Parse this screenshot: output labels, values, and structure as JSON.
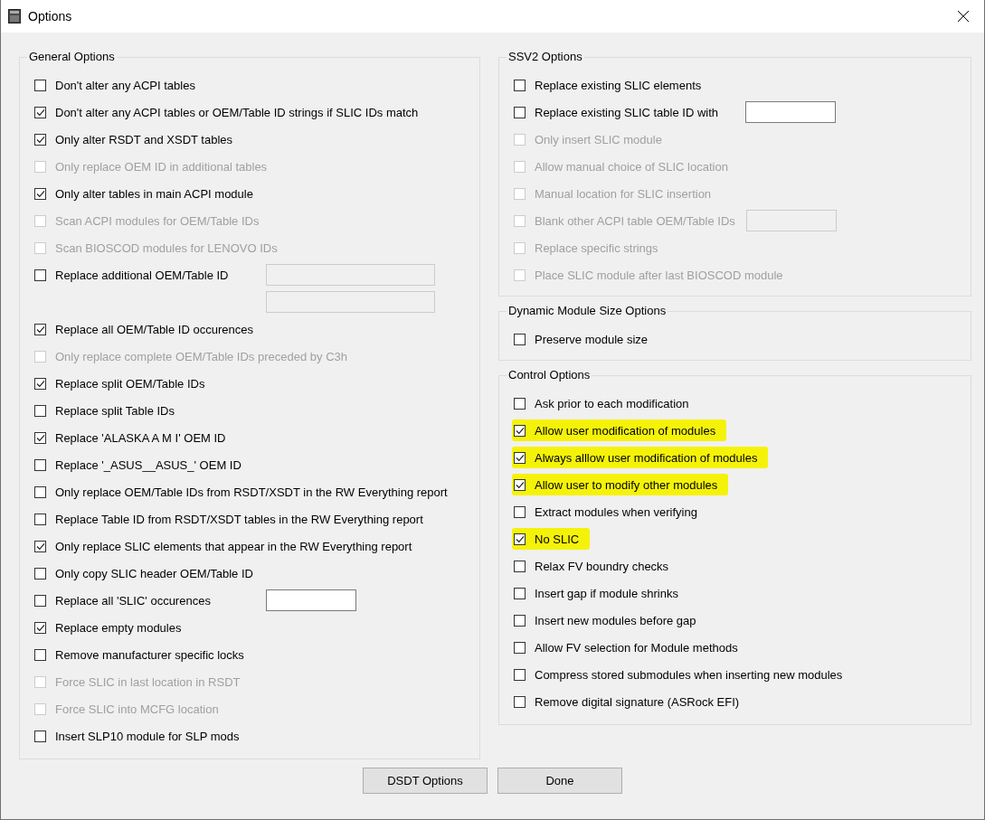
{
  "window": {
    "title": "Options"
  },
  "columns": [
    {
      "groups": [
        {
          "title": "General Options",
          "items": [
            {
              "label": "Don't alter any ACPI tables",
              "checked": false,
              "disabled": false,
              "highlighted": false
            },
            {
              "label": "Don't alter any ACPI tables or OEM/Table ID strings if SLIC IDs match",
              "checked": true,
              "disabled": false,
              "highlighted": false
            },
            {
              "label": "Only alter RSDT and XSDT tables",
              "checked": true,
              "disabled": false,
              "highlighted": false
            },
            {
              "label": "Only replace OEM ID in additional tables",
              "checked": false,
              "disabled": true,
              "highlighted": false
            },
            {
              "label": "Only alter tables in main ACPI module",
              "checked": true,
              "disabled": false,
              "highlighted": false
            },
            {
              "label": "Scan ACPI modules for OEM/Table IDs",
              "checked": false,
              "disabled": true,
              "highlighted": false
            },
            {
              "label": "Scan BIOSCOD modules for LENOVO IDs",
              "checked": false,
              "disabled": true,
              "highlighted": false
            },
            {
              "label": "Replace additional OEM/Table ID",
              "checked": false,
              "disabled": false,
              "highlighted": false,
              "fields": [
                {
                  "disabled": true,
                  "kind": "wide"
                },
                {
                  "disabled": true,
                  "kind": "wide"
                }
              ]
            },
            {
              "label": "Replace all OEM/Table ID occurences",
              "checked": true,
              "disabled": false,
              "highlighted": false
            },
            {
              "label": "Only replace complete OEM/Table IDs preceded by C3h",
              "checked": false,
              "disabled": true,
              "highlighted": false
            },
            {
              "label": "Replace split OEM/Table IDs",
              "checked": true,
              "disabled": false,
              "highlighted": false
            },
            {
              "label": "Replace split Table IDs",
              "checked": false,
              "disabled": false,
              "highlighted": false
            },
            {
              "label": "Replace 'ALASKA A M I'  OEM ID",
              "checked": true,
              "disabled": false,
              "highlighted": false
            },
            {
              "label": "Replace '_ASUS__ASUS_' OEM ID",
              "checked": false,
              "disabled": false,
              "highlighted": false
            },
            {
              "label": "Only replace OEM/Table IDs from RSDT/XSDT in the RW Everything report",
              "checked": false,
              "disabled": false,
              "highlighted": false
            },
            {
              "label": "Replace Table ID from RSDT/XSDT tables in the RW Everything report",
              "checked": false,
              "disabled": false,
              "highlighted": false
            },
            {
              "label": "Only replace SLIC elements that appear in the RW Everything report",
              "checked": true,
              "disabled": false,
              "highlighted": false
            },
            {
              "label": "Only copy SLIC header OEM/Table ID",
              "checked": false,
              "disabled": false,
              "highlighted": false
            },
            {
              "label": "Replace all 'SLIC' occurences",
              "checked": false,
              "disabled": false,
              "highlighted": false,
              "fields": [
                {
                  "disabled": false,
                  "kind": "narrow"
                }
              ]
            },
            {
              "label": "Replace empty modules",
              "checked": true,
              "disabled": false,
              "highlighted": false
            },
            {
              "label": "Remove manufacturer specific locks",
              "checked": false,
              "disabled": false,
              "highlighted": false
            },
            {
              "label": "Force SLIC in last location in RSDT",
              "checked": false,
              "disabled": true,
              "highlighted": false
            },
            {
              "label": "Force SLIC into MCFG location",
              "checked": false,
              "disabled": true,
              "highlighted": false
            },
            {
              "label": "Insert SLP10 module for SLP mods",
              "checked": false,
              "disabled": false,
              "highlighted": false
            }
          ]
        }
      ]
    },
    {
      "groups": [
        {
          "title": "SSV2 Options",
          "items": [
            {
              "label": "Replace existing SLIC elements",
              "checked": false,
              "disabled": false,
              "highlighted": false
            },
            {
              "label": "Replace existing SLIC table ID with",
              "checked": false,
              "disabled": false,
              "highlighted": false,
              "fields": [
                {
                  "disabled": false,
                  "kind": "narrow"
                }
              ]
            },
            {
              "label": "Only insert SLIC module",
              "checked": false,
              "disabled": true,
              "highlighted": false
            },
            {
              "label": "Allow manual choice of SLIC location",
              "checked": false,
              "disabled": true,
              "highlighted": false
            },
            {
              "label": "Manual location for SLIC insertion",
              "checked": false,
              "disabled": true,
              "highlighted": false
            },
            {
              "label": "Blank other ACPI table OEM/Table IDs",
              "checked": false,
              "disabled": true,
              "highlighted": false,
              "fields": [
                {
                  "disabled": true,
                  "kind": "narrow"
                }
              ]
            },
            {
              "label": "Replace specific strings",
              "checked": false,
              "disabled": true,
              "highlighted": false
            },
            {
              "label": "Place SLIC module after last BIOSCOD module",
              "checked": false,
              "disabled": true,
              "highlighted": false
            }
          ]
        },
        {
          "title": "Dynamic Module Size Options",
          "items": [
            {
              "label": "Preserve module size",
              "checked": false,
              "disabled": false,
              "highlighted": false
            }
          ]
        },
        {
          "title": "Control Options",
          "items": [
            {
              "label": "Ask prior to each modification",
              "checked": false,
              "disabled": false,
              "highlighted": false
            },
            {
              "label": "Allow user modification of modules",
              "checked": true,
              "disabled": false,
              "highlighted": true
            },
            {
              "label": "Always alllow user modification of modules",
              "checked": true,
              "disabled": false,
              "highlighted": true
            },
            {
              "label": "Allow user to modify other modules",
              "checked": true,
              "disabled": false,
              "highlighted": true
            },
            {
              "label": "Extract modules when verifying",
              "checked": false,
              "disabled": false,
              "highlighted": false
            },
            {
              "label": "No SLIC",
              "checked": true,
              "disabled": false,
              "highlighted": true
            },
            {
              "label": "Relax FV boundry checks",
              "checked": false,
              "disabled": false,
              "highlighted": false
            },
            {
              "label": "Insert gap if module shrinks",
              "checked": false,
              "disabled": false,
              "highlighted": false
            },
            {
              "label": "Insert new modules before gap",
              "checked": false,
              "disabled": false,
              "highlighted": false
            },
            {
              "label": "Allow FV selection for Module methods",
              "checked": false,
              "disabled": false,
              "highlighted": false
            },
            {
              "label": "Compress stored submodules when inserting new modules",
              "checked": false,
              "disabled": false,
              "highlighted": false
            },
            {
              "label": "Remove digital signature (ASRock EFI)",
              "checked": false,
              "disabled": false,
              "highlighted": false
            }
          ]
        }
      ]
    }
  ],
  "buttons": [
    "DSDT Options",
    "Done"
  ]
}
